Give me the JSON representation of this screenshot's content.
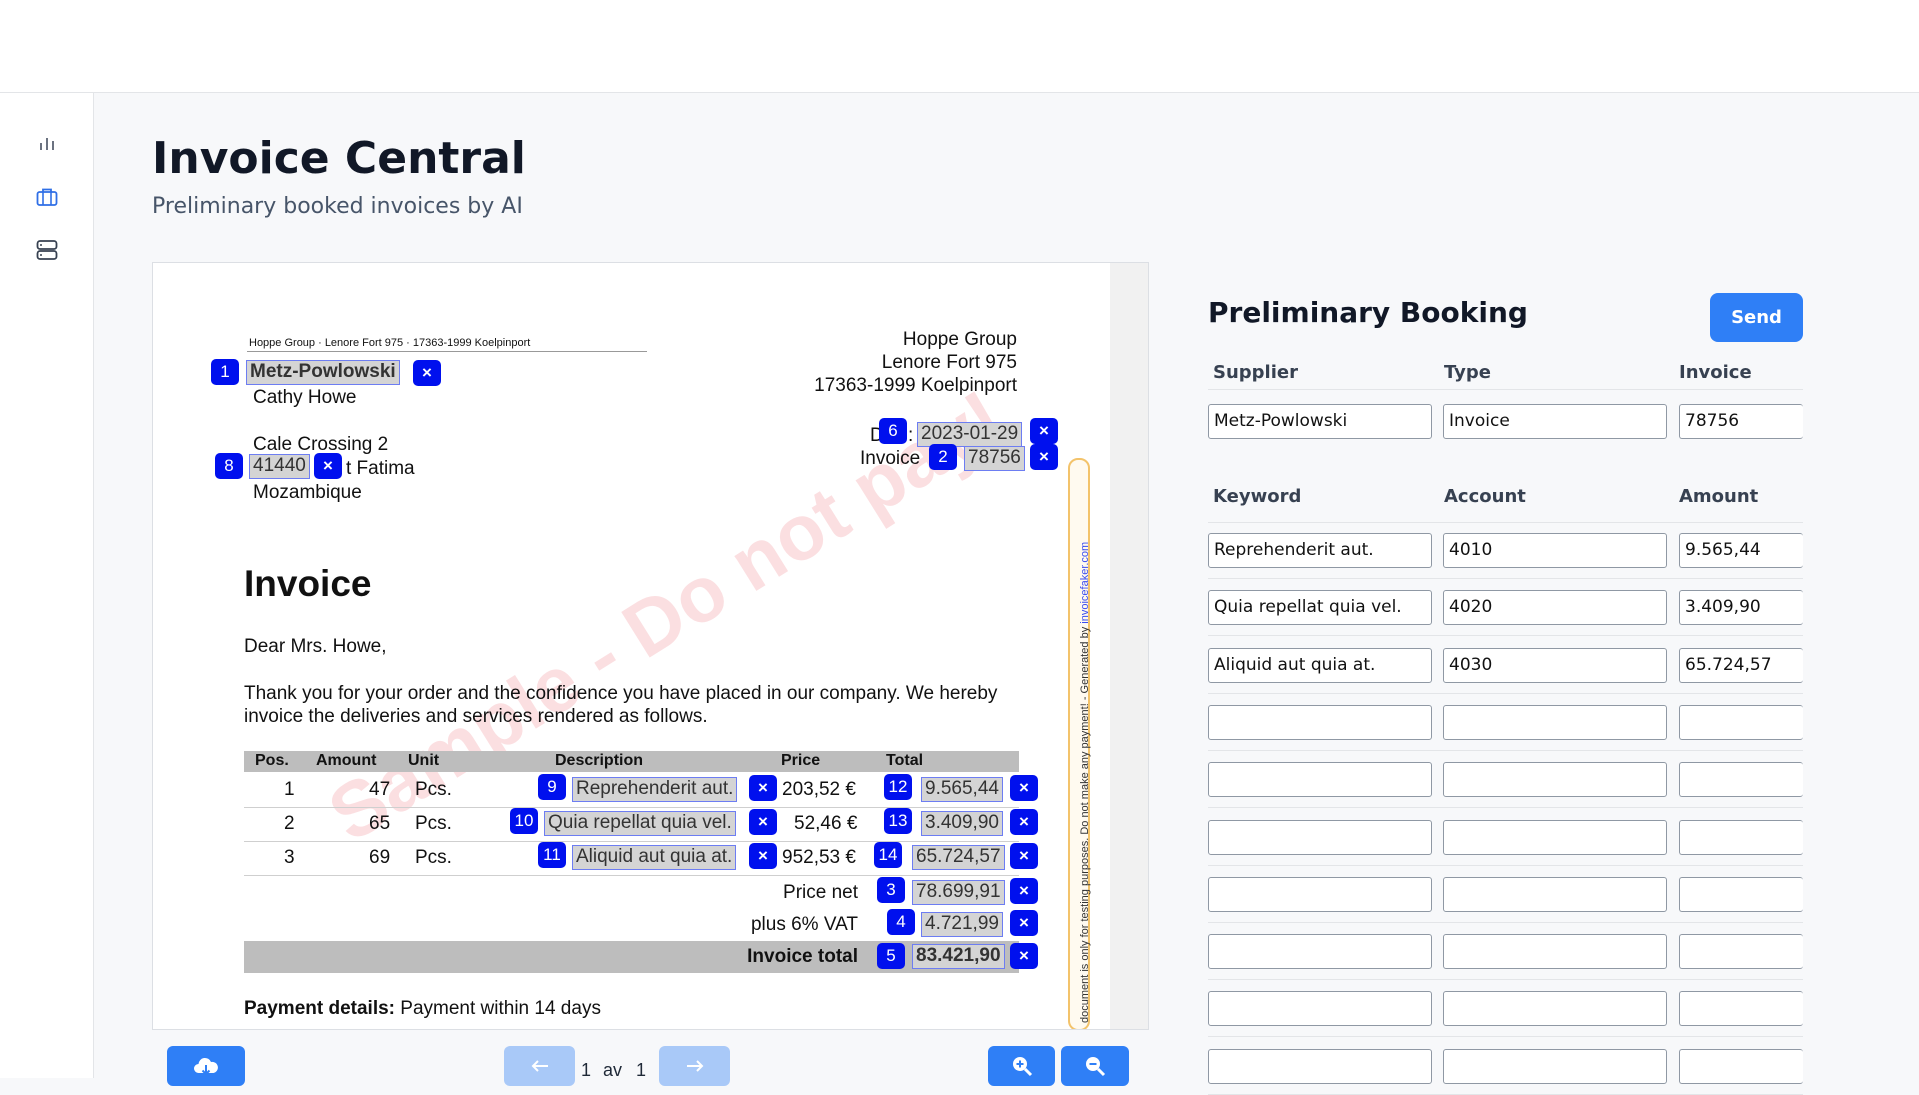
{
  "page": {
    "title": "Invoice Central",
    "subtitle": "Preliminary booked invoices by AI"
  },
  "sidebar": {
    "items": [
      {
        "icon": "bar-chart-icon"
      },
      {
        "icon": "briefcase-icon"
      },
      {
        "icon": "server-icon"
      }
    ]
  },
  "document": {
    "sender_line": "Hoppe Group · Lenore Fort 975 · 17363-1999 Koelpinport",
    "recipient": {
      "company": "Metz-Powlowski",
      "name": "Cathy Howe",
      "street": "Cale Crossing 2",
      "zip": "41440",
      "city_suffix": "t Fatima",
      "country": "Mozambique"
    },
    "issuer": {
      "company": "Hoppe Group",
      "street": "Lenore Fort 975",
      "city": "17363-1999 Koelpinport"
    },
    "date_label_start": "D",
    "date_label_end": ":",
    "date_value": "2023-01-29",
    "invoice_label": "Invoice",
    "invoice_value": "78756",
    "heading": "Invoice",
    "greeting": "Dear Mrs. Howe,",
    "intro_line1": "Thank you for your order and the confidence you have placed in our company. We hereby",
    "intro_line2": "invoice the deliveries and services rendered as follows.",
    "watermark": "Sample - Do not pay!",
    "table": {
      "headers": {
        "pos": "Pos.",
        "amount": "Amount",
        "unit": "Unit",
        "description": "Description",
        "price": "Price",
        "total": "Total"
      },
      "rows": [
        {
          "pos": "1",
          "amount": "47",
          "unit": "Pcs.",
          "description": "Reprehenderit aut.",
          "price": "203,52 €",
          "total": "9.565,44",
          "desc_badge": "9",
          "total_badge": "12"
        },
        {
          "pos": "2",
          "amount": "65",
          "unit": "Pcs.",
          "description": "Quia repellat quia vel.",
          "price": "52,46 €",
          "total": "3.409,90",
          "desc_badge": "10",
          "total_badge": "13"
        },
        {
          "pos": "3",
          "amount": "69",
          "unit": "Pcs.",
          "description": "Aliquid aut quia at.",
          "price": "952,53 €",
          "total": "65.724,57",
          "desc_badge": "11",
          "total_badge": "14"
        }
      ]
    },
    "summary": {
      "net_label": "Price net",
      "net_value": "78.699,91",
      "net_badge": "3",
      "vat_label": "plus 6% VAT",
      "vat_value": "4.721,99",
      "vat_badge": "4",
      "total_label": "Invoice total",
      "total_value": "83.421,90",
      "total_badge": "5"
    },
    "payment_label": "Payment details:",
    "payment_text": "Payment within 14 days",
    "side_note_text": "document is only for testing purposes. Do not make any payment! - Generated by",
    "side_note_link": "invoicefaker.com",
    "badges": {
      "company": "1",
      "invoice": "2",
      "date": "6",
      "zip": "8"
    },
    "close_symbol": "×"
  },
  "viewer_controls": {
    "page_current": "1",
    "page_of": "av",
    "page_total": "1",
    "download_icon": "cloud-download-icon",
    "prev_icon": "arrow-left-icon",
    "next_icon": "arrow-right-icon",
    "zoom_in_icon": "zoom-in-icon",
    "zoom_out_icon": "zoom-out-icon"
  },
  "booking": {
    "title": "Preliminary Booking",
    "send_label": "Send",
    "header_labels": {
      "supplier": "Supplier",
      "type": "Type",
      "invoice": "Invoice"
    },
    "header_values": {
      "supplier": "Metz-Powlowski",
      "type": "Invoice",
      "invoice": "78756"
    },
    "line_labels": {
      "keyword": "Keyword",
      "account": "Account",
      "amount": "Amount"
    },
    "lines": [
      {
        "keyword": "Reprehenderit aut.",
        "account": "4010",
        "amount": "9.565,44"
      },
      {
        "keyword": "Quia repellat quia vel.",
        "account": "4020",
        "amount": "3.409,90"
      },
      {
        "keyword": "Aliquid aut quia at.",
        "account": "4030",
        "amount": "65.724,57"
      },
      {
        "keyword": "",
        "account": "",
        "amount": ""
      },
      {
        "keyword": "",
        "account": "",
        "amount": ""
      },
      {
        "keyword": "",
        "account": "",
        "amount": ""
      },
      {
        "keyword": "",
        "account": "",
        "amount": ""
      },
      {
        "keyword": "",
        "account": "",
        "amount": ""
      },
      {
        "keyword": "",
        "account": "",
        "amount": ""
      },
      {
        "keyword": "",
        "account": "",
        "amount": ""
      }
    ]
  },
  "colors": {
    "accent": "#2f7ff6",
    "badge": "#0010ee"
  }
}
